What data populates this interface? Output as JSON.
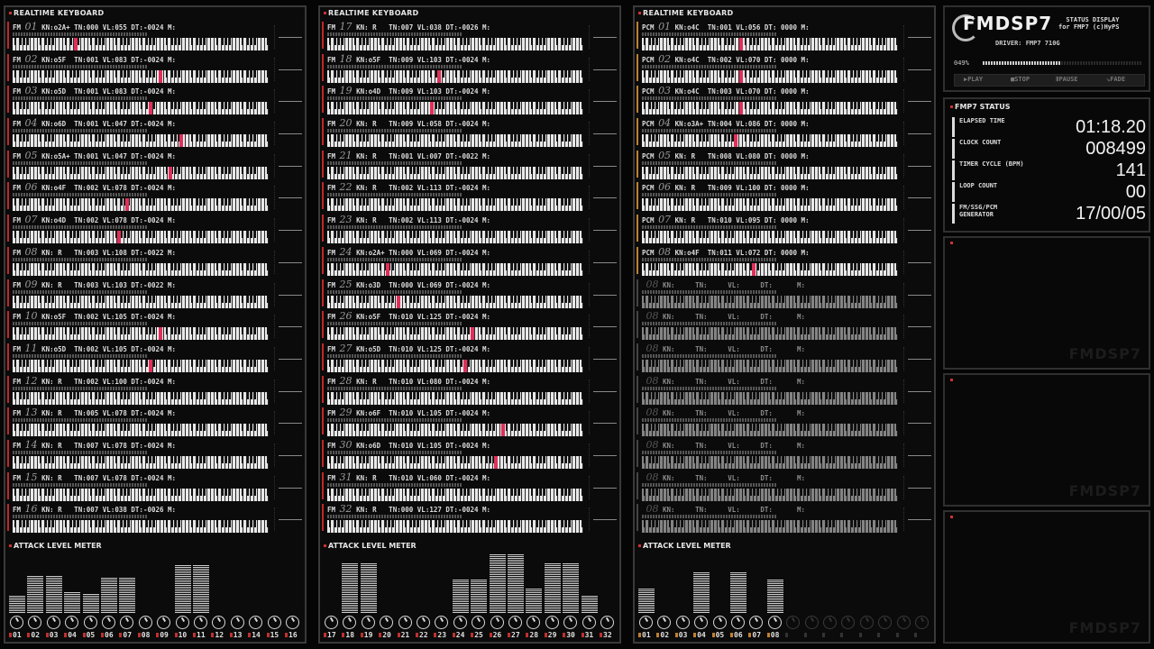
{
  "panels": [
    {
      "title": "REALTIME KEYBOARD",
      "meter_title": "ATTACK LEVEL METER",
      "rows": [
        {
          "type": "FM",
          "num": "01",
          "info": "KN:o2A+ TN:000 VL:055 DT:-0024 M:",
          "key": 0.24,
          "state": "on"
        },
        {
          "type": "FM",
          "num": "02",
          "info": "KN:o5F  TN:001 VL:083 DT:-0024 M:",
          "key": 0.57,
          "state": "on"
        },
        {
          "type": "FM",
          "num": "03",
          "info": "KN:o5D  TN:001 VL:083 DT:-0024 M:",
          "key": 0.53,
          "state": "on"
        },
        {
          "type": "FM",
          "num": "04",
          "info": "KN:o6D  TN:001 VL:047 DT:-0024 M:",
          "key": 0.65,
          "state": "on"
        },
        {
          "type": "FM",
          "num": "05",
          "info": "KN:o5A+ TN:001 VL:047 DT:-0024 M:",
          "key": 0.61,
          "state": "on"
        },
        {
          "type": "FM",
          "num": "06",
          "info": "KN:o4F  TN:002 VL:078 DT:-0024 M:",
          "key": 0.44,
          "state": "on"
        },
        {
          "type": "FM",
          "num": "07",
          "info": "KN:o4D  TN:002 VL:078 DT:-0024 M:",
          "key": 0.41,
          "state": "on"
        },
        {
          "type": "FM",
          "num": "08",
          "info": "KN: R   TN:003 VL:108 DT:-0022 M:",
          "key": null,
          "state": "on"
        },
        {
          "type": "FM",
          "num": "09",
          "info": "KN: R   TN:003 VL:103 DT:-0022 M:",
          "key": null,
          "state": "on"
        },
        {
          "type": "FM",
          "num": "10",
          "info": "KN:o5F  TN:002 VL:105 DT:-0024 M:",
          "key": 0.57,
          "state": "on"
        },
        {
          "type": "FM",
          "num": "11",
          "info": "KN:o5D  TN:002 VL:105 DT:-0024 M:",
          "key": 0.53,
          "state": "on"
        },
        {
          "type": "FM",
          "num": "12",
          "info": "KN: R   TN:002 VL:100 DT:-0024 M:",
          "key": null,
          "state": "on"
        },
        {
          "type": "FM",
          "num": "13",
          "info": "KN: R   TN:005 VL:078 DT:-0024 M:",
          "key": null,
          "state": "on"
        },
        {
          "type": "FM",
          "num": "14",
          "info": "KN: R   TN:007 VL:078 DT:-0024 M:",
          "key": null,
          "state": "on"
        },
        {
          "type": "FM",
          "num": "15",
          "info": "KN: R   TN:007 VL:078 DT:-0024 M:",
          "key": null,
          "state": "on"
        },
        {
          "type": "FM",
          "num": "16",
          "info": "KN: R   TN:007 VL:038 DT:-0026 M:",
          "key": null,
          "state": "on"
        }
      ],
      "levels": [
        0.3,
        0.62,
        0.64,
        0.36,
        0.34,
        0.6,
        0.6,
        0,
        0,
        0.82,
        0.82,
        0,
        0,
        0,
        0,
        0
      ],
      "channels": [
        "01",
        "02",
        "03",
        "04",
        "05",
        "06",
        "07",
        "08",
        "09",
        "10",
        "11",
        "12",
        "13",
        "14",
        "15",
        "16"
      ],
      "knob_active": 16
    },
    {
      "title": "REALTIME KEYBOARD",
      "meter_title": "ATTACK LEVEL METER",
      "rows": [
        {
          "type": "FM",
          "num": "17",
          "info": "KN: R   TN:007 VL:038 DT:-0026 M:",
          "key": null,
          "state": "on"
        },
        {
          "type": "FM",
          "num": "18",
          "info": "KN:o5F  TN:009 VL:103 DT:-0024 M:",
          "key": 0.43,
          "state": "on"
        },
        {
          "type": "FM",
          "num": "19",
          "info": "KN:o4D  TN:009 VL:103 DT:-0024 M:",
          "key": 0.4,
          "state": "on"
        },
        {
          "type": "FM",
          "num": "20",
          "info": "KN: R   TN:009 VL:058 DT:-0024 M:",
          "key": null,
          "state": "on"
        },
        {
          "type": "FM",
          "num": "21",
          "info": "KN: R   TN:001 VL:007 DT:-0022 M:",
          "key": null,
          "state": "on"
        },
        {
          "type": "FM",
          "num": "22",
          "info": "KN: R   TN:002 VL:113 DT:-0024 M:",
          "key": null,
          "state": "on"
        },
        {
          "type": "FM",
          "num": "23",
          "info": "KN: R   TN:002 VL:113 DT:-0024 M:",
          "key": null,
          "state": "on"
        },
        {
          "type": "FM",
          "num": "24",
          "info": "KN:o2A+ TN:000 VL:069 DT:-0024 M:",
          "key": 0.23,
          "state": "on"
        },
        {
          "type": "FM",
          "num": "25",
          "info": "KN:o3D  TN:000 VL:069 DT:-0024 M:",
          "key": 0.27,
          "state": "on"
        },
        {
          "type": "FM",
          "num": "26",
          "info": "KN:o5F  TN:010 VL:125 DT:-0024 M:",
          "key": 0.56,
          "state": "on"
        },
        {
          "type": "FM",
          "num": "27",
          "info": "KN:o5D  TN:010 VL:125 DT:-0024 M:",
          "key": 0.53,
          "state": "on"
        },
        {
          "type": "FM",
          "num": "28",
          "info": "KN: R   TN:010 VL:080 DT:-0024 M:",
          "key": null,
          "state": "on"
        },
        {
          "type": "FM",
          "num": "29",
          "info": "KN:o6F  TN:010 VL:105 DT:-0024 M:",
          "key": 0.68,
          "state": "on"
        },
        {
          "type": "FM",
          "num": "30",
          "info": "KN:o6D  TN:010 VL:105 DT:-0024 M:",
          "key": 0.65,
          "state": "on"
        },
        {
          "type": "FM",
          "num": "31",
          "info": "KN: R   TN:010 VL:060 DT:-0024 M:",
          "key": null,
          "state": "on"
        },
        {
          "type": "FM",
          "num": "32",
          "info": "KN: R   TN:000 VL:127 DT:-0024 M:",
          "key": null,
          "state": "on"
        }
      ],
      "levels": [
        0,
        0.84,
        0.84,
        0,
        0,
        0,
        0,
        0.56,
        0.56,
        1,
        1,
        0.42,
        0.84,
        0.84,
        0.3,
        0
      ],
      "channels": [
        "17",
        "18",
        "19",
        "20",
        "21",
        "22",
        "23",
        "24",
        "25",
        "26",
        "27",
        "28",
        "29",
        "30",
        "31",
        "32"
      ],
      "knob_active": 16
    },
    {
      "title": "REALTIME KEYBOARD",
      "meter_title": "ATTACK LEVEL METER",
      "rows": [
        {
          "type": "PCM",
          "num": "01",
          "info": "KN:o4C  TN:001 VL:056 DT: 0000 M:",
          "key": 0.38,
          "state": "pcm"
        },
        {
          "type": "PCM",
          "num": "02",
          "info": "KN:o4C  TN:002 VL:070 DT: 0000 M:",
          "key": 0.38,
          "state": "pcm"
        },
        {
          "type": "PCM",
          "num": "03",
          "info": "KN:o4C  TN:003 VL:070 DT: 0000 M:",
          "key": 0.38,
          "state": "pcm"
        },
        {
          "type": "PCM",
          "num": "04",
          "info": "KN:o3A+ TN:004 VL:086 DT: 0000 M:",
          "key": 0.36,
          "state": "pcm"
        },
        {
          "type": "PCM",
          "num": "05",
          "info": "KN: R   TN:008 VL:080 DT: 0000 M:",
          "key": null,
          "state": "pcm"
        },
        {
          "type": "PCM",
          "num": "06",
          "info": "KN: R   TN:009 VL:100 DT: 0000 M:",
          "key": null,
          "state": "pcm"
        },
        {
          "type": "PCM",
          "num": "07",
          "info": "KN: R   TN:010 VL:095 DT: 0000 M:",
          "key": null,
          "state": "pcm"
        },
        {
          "type": "PCM",
          "num": "08",
          "info": "KN:o4F  TN:011 VL:072 DT: 0000 M:",
          "key": 0.43,
          "state": "pcm"
        },
        {
          "type": "",
          "num": "08",
          "info": "KN:     TN:     VL:     DT:      M:",
          "key": null,
          "state": "off"
        },
        {
          "type": "",
          "num": "08",
          "info": "KN:     TN:     VL:     DT:      M:",
          "key": null,
          "state": "off"
        },
        {
          "type": "",
          "num": "08",
          "info": "KN:     TN:     VL:     DT:      M:",
          "key": null,
          "state": "off"
        },
        {
          "type": "",
          "num": "08",
          "info": "KN:     TN:     VL:     DT:      M:",
          "key": null,
          "state": "off"
        },
        {
          "type": "",
          "num": "08",
          "info": "KN:     TN:     VL:     DT:      M:",
          "key": null,
          "state": "off"
        },
        {
          "type": "",
          "num": "08",
          "info": "KN:     TN:     VL:     DT:      M:",
          "key": null,
          "state": "off"
        },
        {
          "type": "",
          "num": "08",
          "info": "KN:     TN:     VL:     DT:      M:",
          "key": null,
          "state": "off"
        },
        {
          "type": "",
          "num": "08",
          "info": "KN:     TN:     VL:     DT:      M:",
          "key": null,
          "state": "off"
        }
      ],
      "levels": [
        0.42,
        0,
        0,
        0.7,
        0,
        0.7,
        0,
        0.58,
        0,
        0,
        0,
        0,
        0,
        0,
        0,
        0
      ],
      "channels": [
        "01",
        "02",
        "03",
        "04",
        "05",
        "06",
        "07",
        "08"
      ],
      "knob_active": 8
    }
  ],
  "status_display": {
    "logo": "FMDSP7",
    "subtitle_line1": "STATUS DISPLAY",
    "subtitle_line2": "for FMP7 (c)HyPS",
    "driver": "DRIVER: FMP7  710G",
    "progress_text": "049%",
    "progress": 0.49,
    "buttons": [
      "▶PLAY",
      "■STOP",
      "ⅡPAUSE",
      "⇘FADE"
    ]
  },
  "fmp7_status": {
    "title": "FMP7 STATUS",
    "rows": [
      {
        "label": "ELAPSED TIME",
        "value": "01:18.20"
      },
      {
        "label": "CLOCK COUNT",
        "value": "008499"
      },
      {
        "label": "TIMER CYCLE (BPM)",
        "value": "141"
      },
      {
        "label": "LOOP COUNT",
        "value": "00"
      },
      {
        "label": "FM/SSG/PCM GENERATOR",
        "value": "17/00/05"
      }
    ]
  },
  "watermark": "FMDSP7"
}
